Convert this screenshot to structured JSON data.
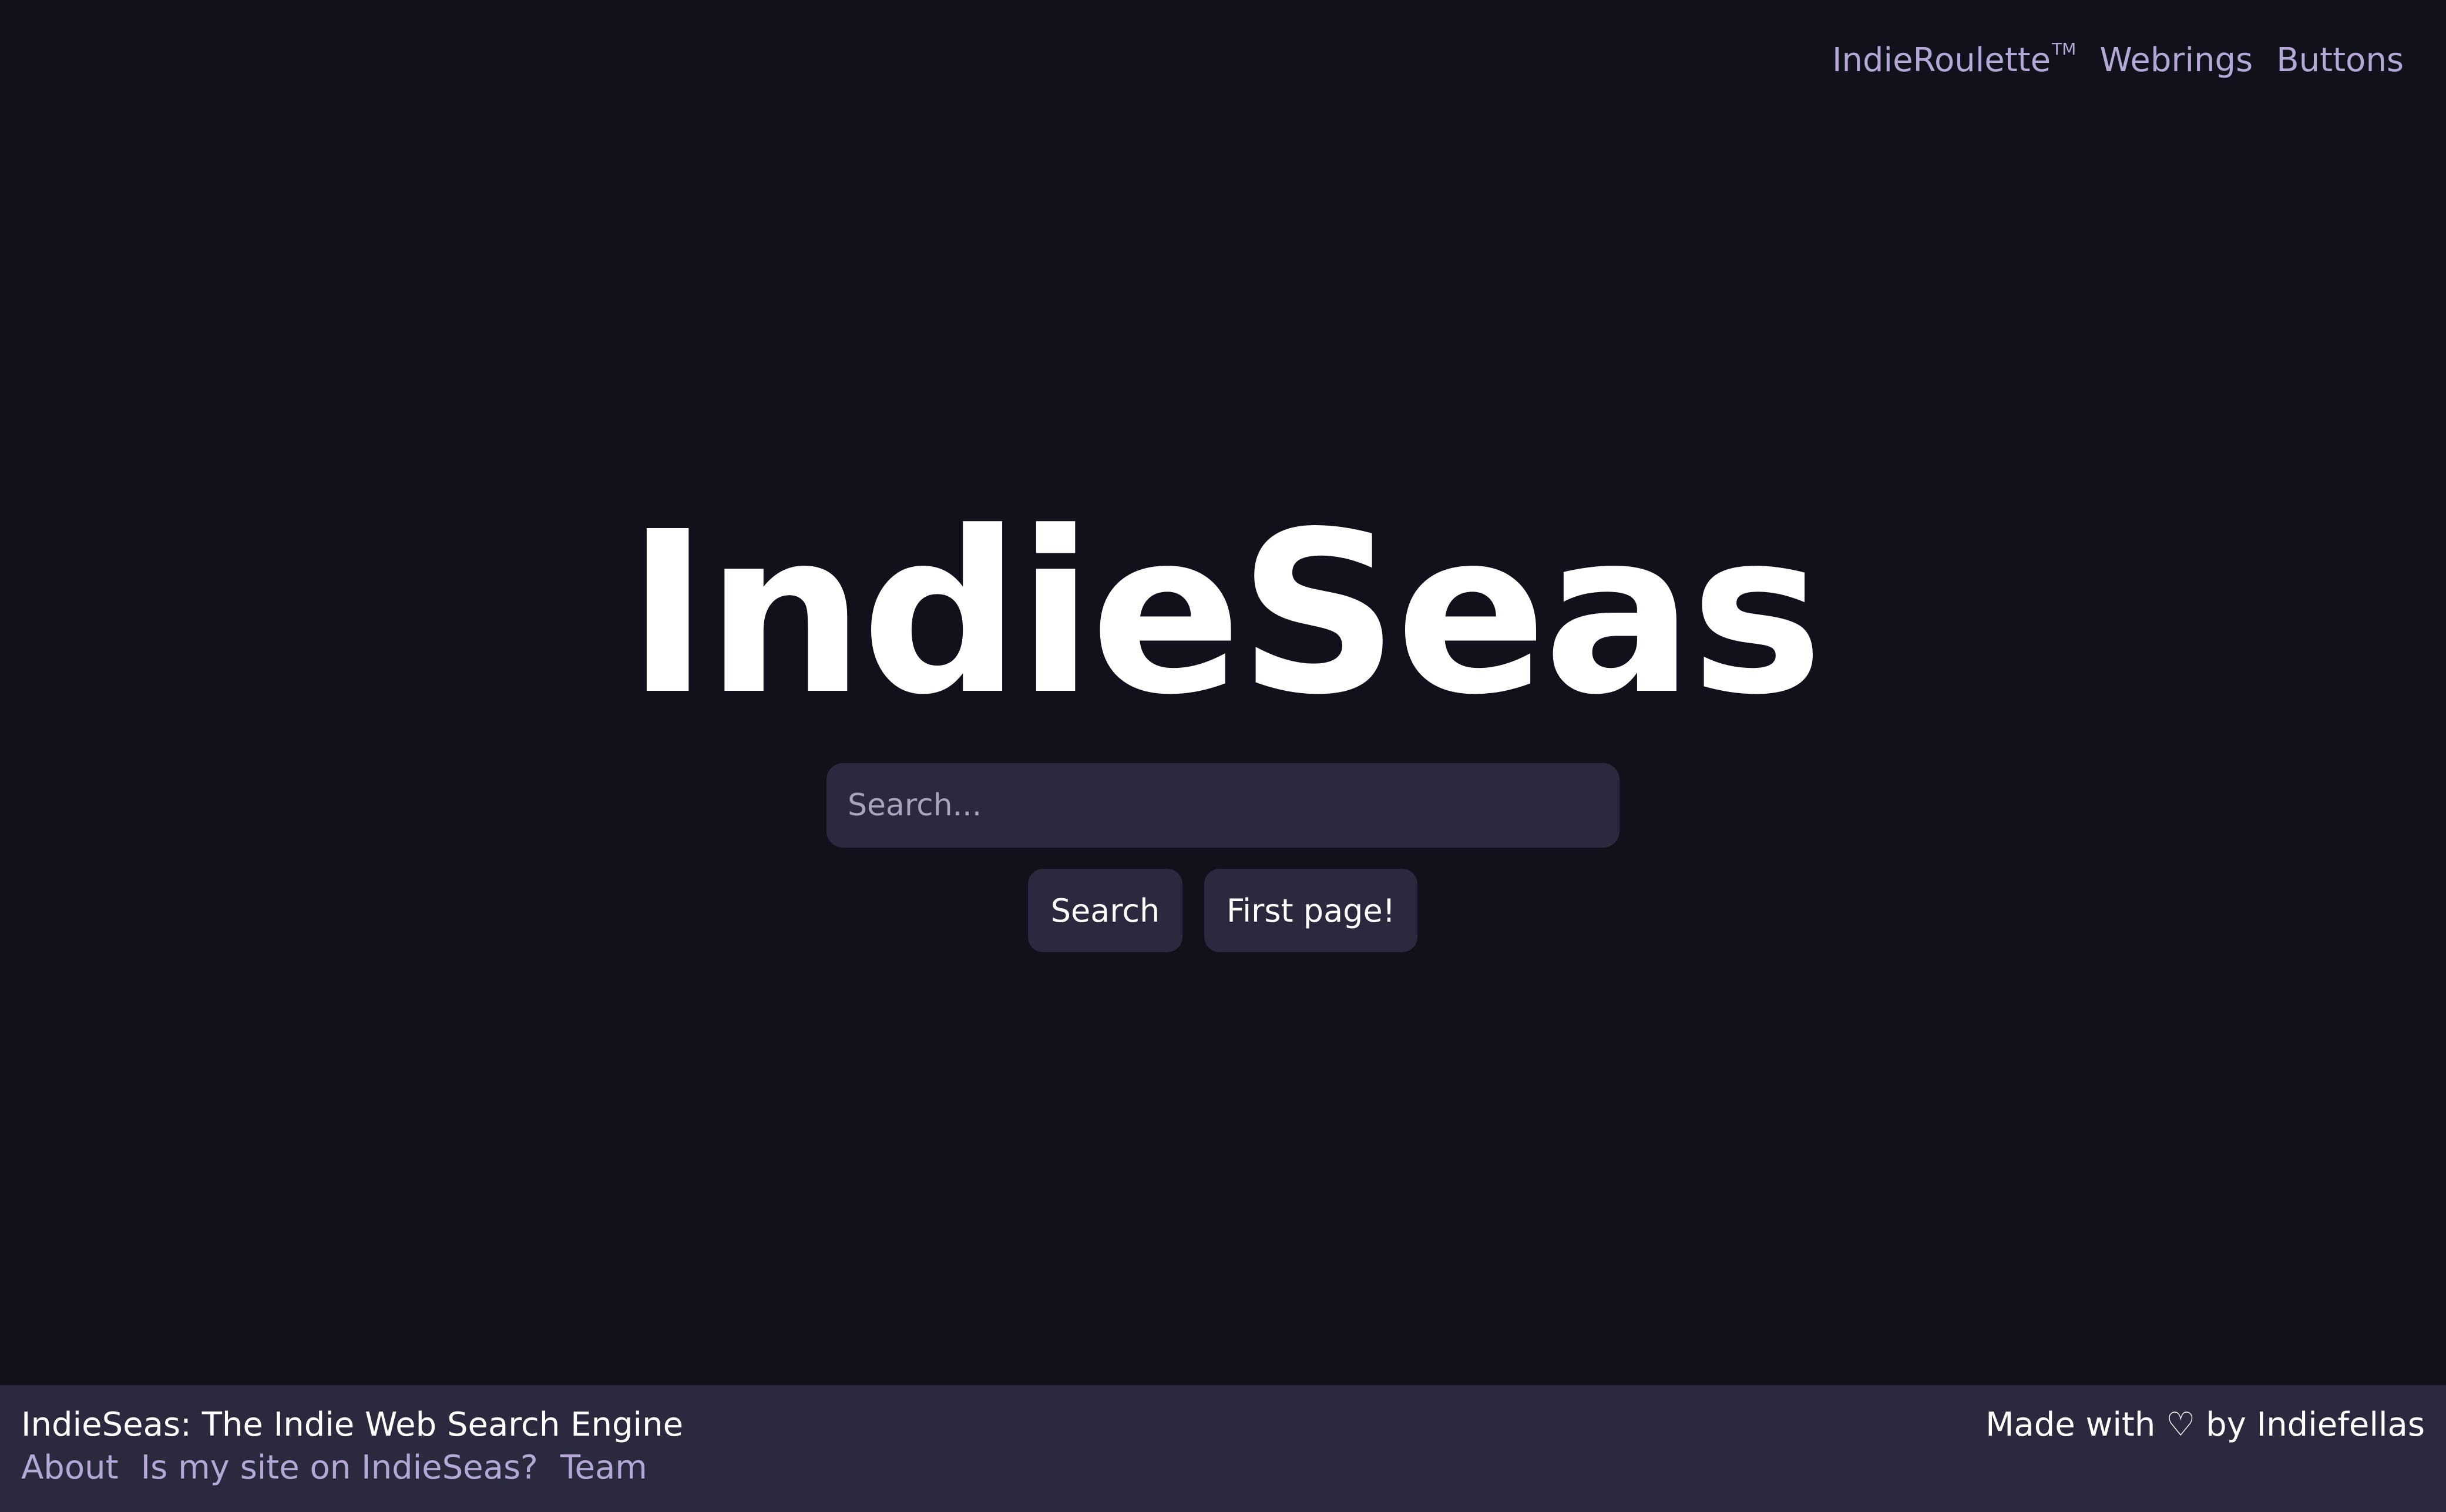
{
  "nav": {
    "roulette": "IndieRoulette",
    "roulette_tm": "TM",
    "webrings": "Webrings",
    "buttons": "Buttons"
  },
  "logo": "IndieSeas",
  "search": {
    "placeholder": "Search...",
    "value": "",
    "search_button": "Search",
    "first_page_button": "First page!"
  },
  "footer": {
    "title": "IndieSeas: The Indie Web Search Engine",
    "links": [
      "About",
      "Is my site on IndieSeas?",
      "Team"
    ],
    "made_with": "Made with ♡ by Indiefellas"
  },
  "colors": {
    "background": "#11111b",
    "surface": "#2a293d",
    "link": "#b4a9d6",
    "text": "#ffffff"
  }
}
